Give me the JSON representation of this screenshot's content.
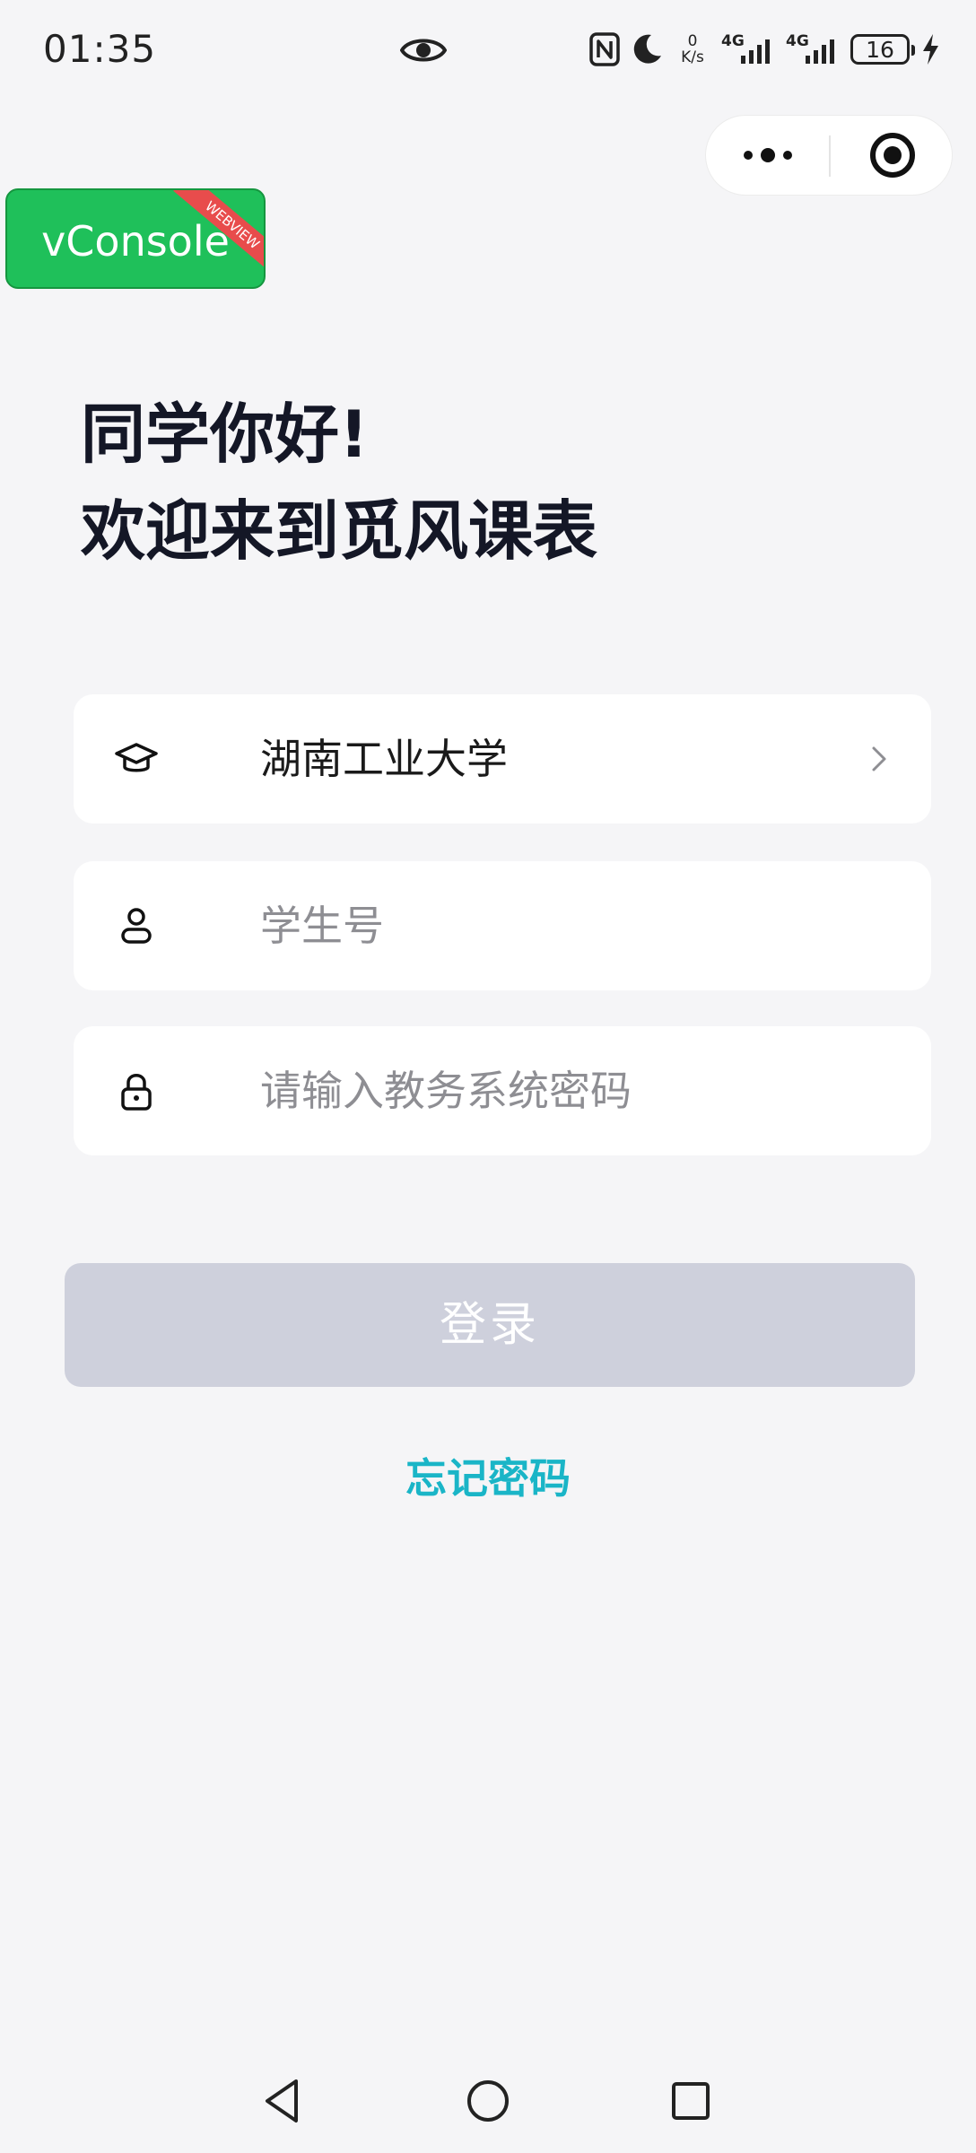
{
  "status_bar": {
    "time": "01:35",
    "net_speed_value": "0",
    "net_speed_unit": "K/s",
    "sim1_network": "4G",
    "sim2_network": "4G",
    "battery_level": "16"
  },
  "vconsole": {
    "label": "vConsole",
    "ribbon": "WEBVIEW"
  },
  "welcome": {
    "line1": "同学你好!",
    "line2": "欢迎来到觅风课表"
  },
  "form": {
    "school": {
      "value": "湖南工业大学",
      "icon": "graduation-cap-icon"
    },
    "student_id": {
      "placeholder": "学生号",
      "value": "",
      "icon": "user-icon"
    },
    "password": {
      "placeholder": "请输入教务系统密码",
      "value": "",
      "icon": "lock-icon"
    }
  },
  "login_button": {
    "label": "登录",
    "background": "#ced0dc"
  },
  "forgot_password": {
    "label": "忘记密码",
    "color": "#1ab5c7"
  },
  "colors": {
    "page_background": "#f5f5f7",
    "title_text": "#141726",
    "placeholder_text": "#8e8e93",
    "vconsole_green": "#1fc05a"
  }
}
